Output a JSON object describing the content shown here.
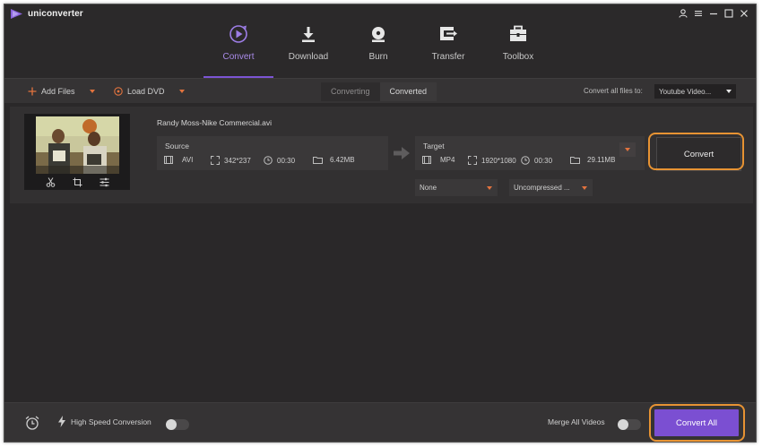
{
  "app": {
    "title": "uniconverter"
  },
  "nav": {
    "items": [
      {
        "label": "Convert",
        "icon": "convert-icon",
        "active": true
      },
      {
        "label": "Download",
        "icon": "download-icon",
        "active": false
      },
      {
        "label": "Burn",
        "icon": "burn-disc-icon",
        "active": false
      },
      {
        "label": "Transfer",
        "icon": "transfer-icon",
        "active": false
      },
      {
        "label": "Toolbox",
        "icon": "toolbox-icon",
        "active": false
      }
    ]
  },
  "toolbar": {
    "add_files": "Add Files",
    "load_dvd": "Load DVD",
    "tabs": [
      "Converting",
      "Converted"
    ],
    "active_tab": "Converted",
    "convert_all_label": "Convert all files to:",
    "convert_all_value": "Youtube Video..."
  },
  "item": {
    "filename": "Randy Moss-Nike Commercial.avi",
    "source": {
      "header": "Source",
      "format": "AVI",
      "resolution": "342*237",
      "duration": "00:30",
      "size": "6.42MB"
    },
    "target": {
      "header": "Target",
      "format": "MP4",
      "resolution": "1920*1080",
      "duration": "00:30",
      "size": "29.11MB"
    },
    "subtitle_select": "None",
    "audio_select": "Uncompressed ...",
    "convert_button": "Convert"
  },
  "footer": {
    "high_speed": "High Speed Conversion",
    "merge": "Merge All Videos",
    "convert_all": "Convert All"
  },
  "colors": {
    "accent": "#7b4fd2",
    "active_text": "#a98be8",
    "orange": "#e2733e",
    "highlight": "#e79333",
    "bg": "#2a2829"
  }
}
